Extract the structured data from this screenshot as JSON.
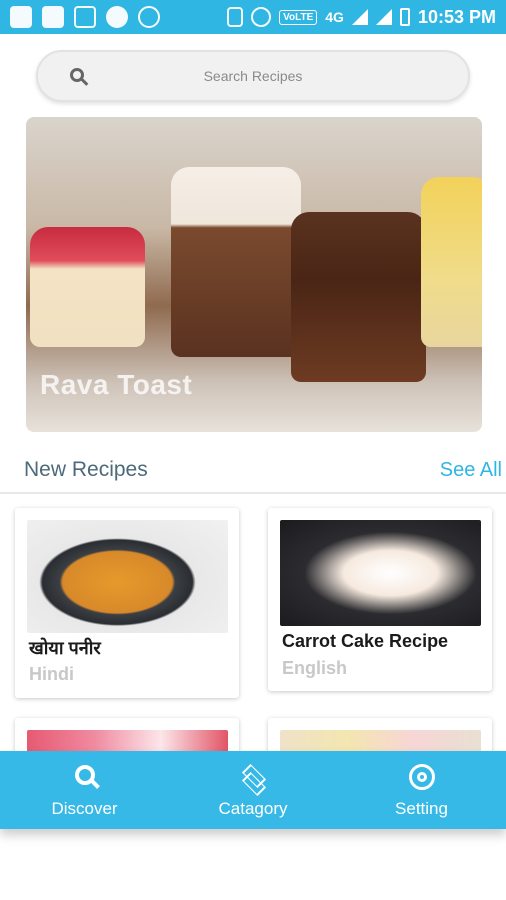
{
  "status_bar": {
    "network": "4G",
    "carrier_label": "VoLTE",
    "time": "10:53 PM"
  },
  "search": {
    "placeholder": "Search Recipes"
  },
  "banner": {
    "title": "Rava Toast"
  },
  "new_recipes": {
    "title": "New Recipes",
    "see_all": "See All",
    "cards": [
      {
        "title": "खोया पनीर",
        "language": "Hindi"
      },
      {
        "title": "Carrot Cake Recipe",
        "language": "English"
      }
    ]
  },
  "bottom_nav": {
    "items": [
      {
        "label": "Discover",
        "icon": "search-icon"
      },
      {
        "label": "Catagory",
        "icon": "layers-icon"
      },
      {
        "label": "Setting",
        "icon": "gear-icon"
      }
    ]
  },
  "colors": {
    "accent": "#2fb6e3",
    "nav_bg": "#36b9e7"
  }
}
